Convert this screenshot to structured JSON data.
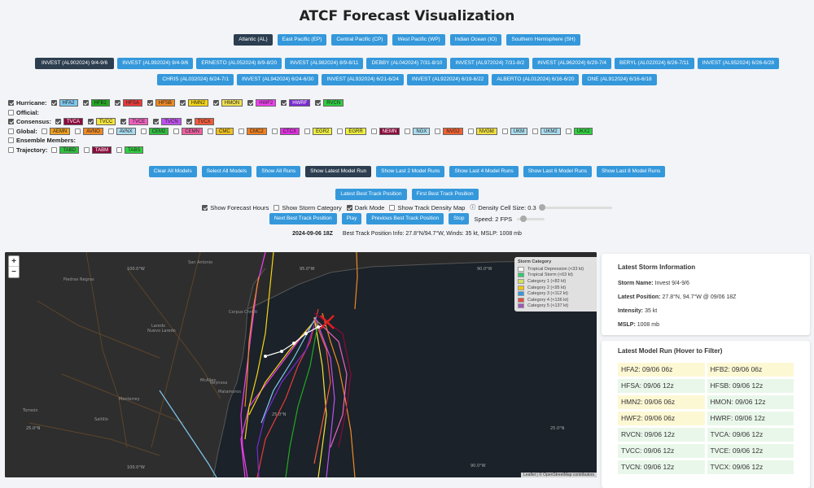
{
  "title": "ATCF Forecast Visualization",
  "basins": [
    "Atlantic (AL)",
    "East Pacific (EP)",
    "Central Pacific (CP)",
    "West Pacific (WP)",
    "Indian Ocean (IO)",
    "Southern Hemisphere (SH)"
  ],
  "storms_row1": [
    "INVEST (AL902024) 9/4-9/6",
    "INVEST (AL992024) 9/4-9/6",
    "ERNESTO (AL052024) 8/9-8/20",
    "INVEST (AL982024) 8/9-8/11",
    "DEBBY (AL042024) 7/31-8/10",
    "INVEST (AL972024) 7/31-8/2",
    "INVEST (AL962024) 6/29-7/4",
    "BERYL (AL022024) 6/26-7/11",
    "INVEST (AL952024) 6/26-6/28"
  ],
  "storms_row2": [
    "CHRIS (AL032024) 6/24-7/1",
    "INVEST (AL942024) 6/24-6/30",
    "INVEST (AL932024) 6/21-6/24",
    "INVEST (AL922024) 6/19-6/22",
    "ALBERTO (AL012024) 6/16-6/20",
    "ONE (AL912024) 6/16-6/18"
  ],
  "model_groups": [
    {
      "label": "Hurricane:",
      "checked": true,
      "models": [
        {
          "name": "HFA2",
          "color": "#7ec8f0",
          "checked": true
        },
        {
          "name": "HFB2",
          "color": "#22aa22",
          "checked": true
        },
        {
          "name": "HFSA",
          "color": "#e83a3a",
          "checked": true
        },
        {
          "name": "HFSB",
          "color": "#f08a24",
          "checked": true
        },
        {
          "name": "HMN2",
          "color": "#f5d516",
          "checked": true
        },
        {
          "name": "HMON",
          "color": "#f0e050",
          "checked": true
        },
        {
          "name": "HWF2",
          "color": "#f040f0",
          "checked": true
        },
        {
          "name": "HWRF",
          "color": "#7a2ad0",
          "checked": true
        },
        {
          "name": "RVCN",
          "color": "#2ecc40",
          "checked": true
        }
      ]
    },
    {
      "label": "Official:",
      "checked": false,
      "models": []
    },
    {
      "label": "Consensus:",
      "checked": true,
      "models": [
        {
          "name": "TVCA",
          "color": "#8b0a3c",
          "checked": true
        },
        {
          "name": "TVCC",
          "color": "#f5e43a",
          "checked": true
        },
        {
          "name": "TVCE",
          "color": "#f060c0",
          "checked": true
        },
        {
          "name": "TVCN",
          "color": "#c050f0",
          "checked": true
        },
        {
          "name": "TVCX",
          "color": "#f05a3a",
          "checked": true
        }
      ]
    },
    {
      "label": "Global:",
      "checked": false,
      "models": [
        {
          "name": "AEMN",
          "color": "#f0a020",
          "checked": false
        },
        {
          "name": "AVNO",
          "color": "#f08a24",
          "checked": false
        },
        {
          "name": "AVNX",
          "color": "#aaddf0",
          "checked": false
        },
        {
          "name": "CEM2",
          "color": "#30c040",
          "checked": false
        },
        {
          "name": "CEMN",
          "color": "#f060a0",
          "checked": false
        },
        {
          "name": "CMC",
          "color": "#f0c020",
          "checked": false
        },
        {
          "name": "CMC2",
          "color": "#f08020",
          "checked": false
        },
        {
          "name": "CTCX",
          "color": "#e030e0",
          "checked": false
        },
        {
          "name": "EGR2",
          "color": "#f0f040",
          "checked": false
        },
        {
          "name": "EGRR",
          "color": "#f0f040",
          "checked": false
        },
        {
          "name": "NEMN",
          "color": "#8b0a3c",
          "checked": false
        },
        {
          "name": "NGX",
          "color": "#aaddf0",
          "checked": false
        },
        {
          "name": "NVG2",
          "color": "#f06030",
          "checked": false
        },
        {
          "name": "NVGM",
          "color": "#f0e040",
          "checked": false
        },
        {
          "name": "UKM",
          "color": "#aaddf0",
          "checked": false
        },
        {
          "name": "UKM2",
          "color": "#aaddf0",
          "checked": false
        },
        {
          "name": "UKX2",
          "color": "#30d040",
          "checked": false
        }
      ]
    },
    {
      "label": "Ensemble Members:",
      "checked": false,
      "models": []
    },
    {
      "label": "Trajectory:",
      "checked": false,
      "models": [
        {
          "name": "TABD",
          "color": "#30c040",
          "checked": false
        },
        {
          "name": "TABM",
          "color": "#8b0a3c",
          "checked": false
        },
        {
          "name": "TABS",
          "color": "#30d040",
          "checked": false
        }
      ]
    }
  ],
  "model_buttons": [
    "Clear All Models",
    "Select All Models",
    "Show All Runs",
    "Show Latest Model Run",
    "Show Last 2 Model Runs",
    "Show Last 4 Model Runs",
    "Show Last 6 Model Runs",
    "Show Last 8 Model Runs"
  ],
  "best_track_buttons": [
    "Latest Best Track Position",
    "First Best Track Position"
  ],
  "options": {
    "forecast_hours": "Show Forecast Hours",
    "storm_category": "Show Storm Category",
    "dark_mode": "Dark Mode",
    "density_map": "Show Track Density Map",
    "density_cell": "Density Cell Size: 0.3"
  },
  "playback": {
    "next": "Next Best Track Position",
    "play": "Play",
    "previous": "Previous Best Track Position",
    "stop": "Stop",
    "speed": "Speed: 2 FPS"
  },
  "status": {
    "datetime": "2024-09-06 18Z",
    "info": "Best Track Position Info: 27.8°N/94.7°W, Winds: 35 kt, MSLP: 1008 mb"
  },
  "map": {
    "zoom_in": "+",
    "zoom_out": "−",
    "legend_title": "Storm Category",
    "legend": [
      {
        "label": "Tropical Depression (<33 kt)",
        "color": "#ffffff"
      },
      {
        "label": "Tropical Storm (<63 kt)",
        "color": "#2ecc71"
      },
      {
        "label": "Category 1 (<82 kt)",
        "color": "#d4e157"
      },
      {
        "label": "Category 2 (<95 kt)",
        "color": "#f1c40f"
      },
      {
        "label": "Category 3 (<112 kt)",
        "color": "#3498db"
      },
      {
        "label": "Category 4 (<136 kt)",
        "color": "#e74c3c"
      },
      {
        "label": "Category 5 (<137 kt)",
        "color": "#9b59b6"
      }
    ],
    "attribution": "Leaflet | © OpenStreetMap contributors",
    "places": [
      "San Antonio",
      "Corpus Christi",
      "Nuevo Laredo",
      "Laredo",
      "Monterrey",
      "Reynosa",
      "McAllen",
      "Matamoros",
      "Saltillo",
      "Torreón",
      "Piedras Negras"
    ],
    "gridlabels": [
      "100.0°W",
      "95.0°W",
      "90.0°W",
      "25.0°N",
      "25.0°N",
      "100.0°W",
      "95.0°W",
      "90.0°W",
      "25.0°N"
    ]
  },
  "storm_info": {
    "heading": "Latest Storm Information",
    "name_label": "Storm Name:",
    "name": "Invest 9/4-9/6",
    "position_label": "Latest Position:",
    "position": "27.8°N, 94.7°W @ 09/06 18Z",
    "intensity_label": "Intensity:",
    "intensity": "35 kt",
    "mslp_label": "MSLP:",
    "mslp": "1008 mb"
  },
  "model_run": {
    "heading": "Latest Model Run (Hover to Filter)",
    "cells": [
      {
        "text": "HFA2: 09/06 06z",
        "bg": "#fdf8d4"
      },
      {
        "text": "HFB2: 09/06 06z",
        "bg": "#fdf8d4"
      },
      {
        "text": "HFSA: 09/06 12z",
        "bg": "#e9f7ea"
      },
      {
        "text": "HFSB: 09/06 12z",
        "bg": "#e9f7ea"
      },
      {
        "text": "HMN2: 09/06 06z",
        "bg": "#fdf8d4"
      },
      {
        "text": "HMON: 09/06 12z",
        "bg": "#e9f7ea"
      },
      {
        "text": "HWF2: 09/06 06z",
        "bg": "#fdf8d4"
      },
      {
        "text": "HWRF: 09/06 12z",
        "bg": "#e9f7ea"
      },
      {
        "text": "RVCN: 09/06 12z",
        "bg": "#e9f7ea"
      },
      {
        "text": "TVCA: 09/06 12z",
        "bg": "#e9f7ea"
      },
      {
        "text": "TVCC: 09/06 12z",
        "bg": "#e9f7ea"
      },
      {
        "text": "TVCE: 09/06 12z",
        "bg": "#e9f7ea"
      },
      {
        "text": "TVCN: 09/06 12z",
        "bg": "#e9f7ea"
      },
      {
        "text": "TVCX: 09/06 12z",
        "bg": "#e9f7ea"
      }
    ]
  }
}
